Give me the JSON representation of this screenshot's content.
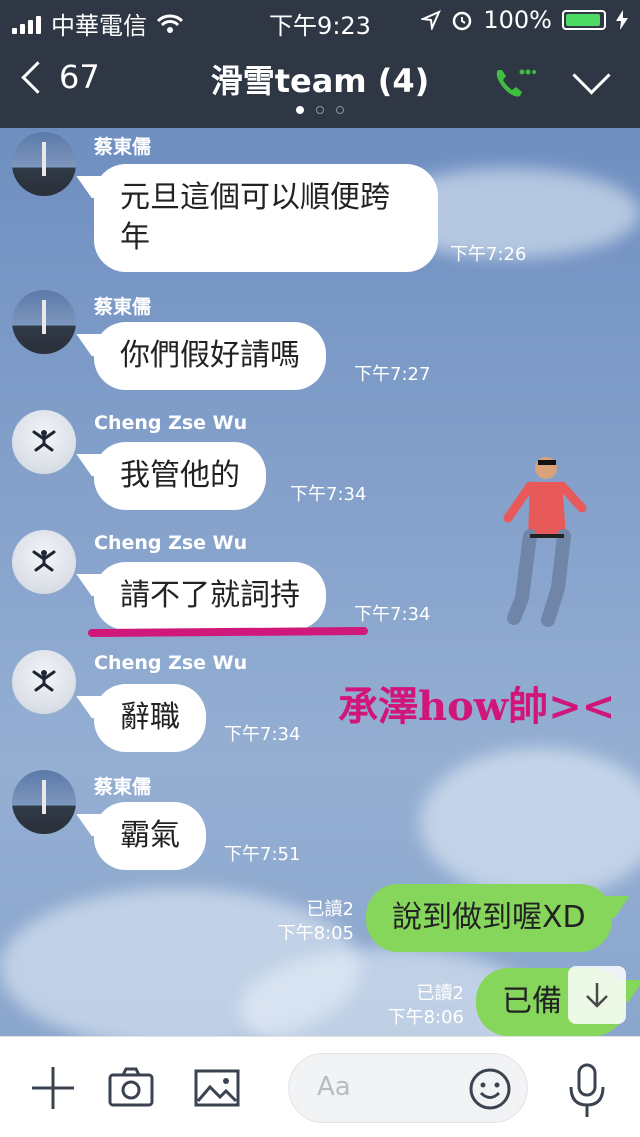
{
  "status_bar": {
    "carrier": "中華電信",
    "time": "下午9:23",
    "battery": "100%"
  },
  "nav": {
    "back_count": "67",
    "title": "滑雪team (4)",
    "page_dots": 3,
    "active_dot": 0
  },
  "messages": [
    {
      "sender": "蔡東儒",
      "text": "元旦這個可以順便跨年",
      "time": "下午7:26",
      "avatar": "rocket-avatar"
    },
    {
      "sender": "蔡東儒",
      "text": "你們假好請嗎",
      "time": "下午7:27",
      "avatar": "rocket-avatar"
    },
    {
      "sender": "Cheng Zse Wu",
      "text": "我管他的",
      "time": "下午7:34",
      "avatar": "snow-angel-avatar"
    },
    {
      "sender": "Cheng Zse Wu",
      "text": "請不了就詞持",
      "time": "下午7:34",
      "avatar": "snow-angel-avatar"
    },
    {
      "sender": "Cheng Zse Wu",
      "text": "辭職",
      "time": "下午7:34",
      "avatar": "snow-angel-avatar"
    },
    {
      "sender": "蔡東儒",
      "text": "霸氣",
      "time": "下午7:51",
      "avatar": "rocket-avatar"
    }
  ],
  "outgoing": [
    {
      "text": "說到做到喔XD",
      "read": "已讀2",
      "time": "下午8:05"
    },
    {
      "text": "已備",
      "read": "已讀2",
      "time": "下午8:06"
    }
  ],
  "overlay": {
    "annotation": "承澤how帥><",
    "annotation_color": "#d1167a"
  },
  "input": {
    "placeholder": "Aa"
  },
  "colors": {
    "nav_bg": "#2f3745",
    "outgoing_bubble": "#86d65c",
    "call_icon": "#3fbf3f"
  }
}
